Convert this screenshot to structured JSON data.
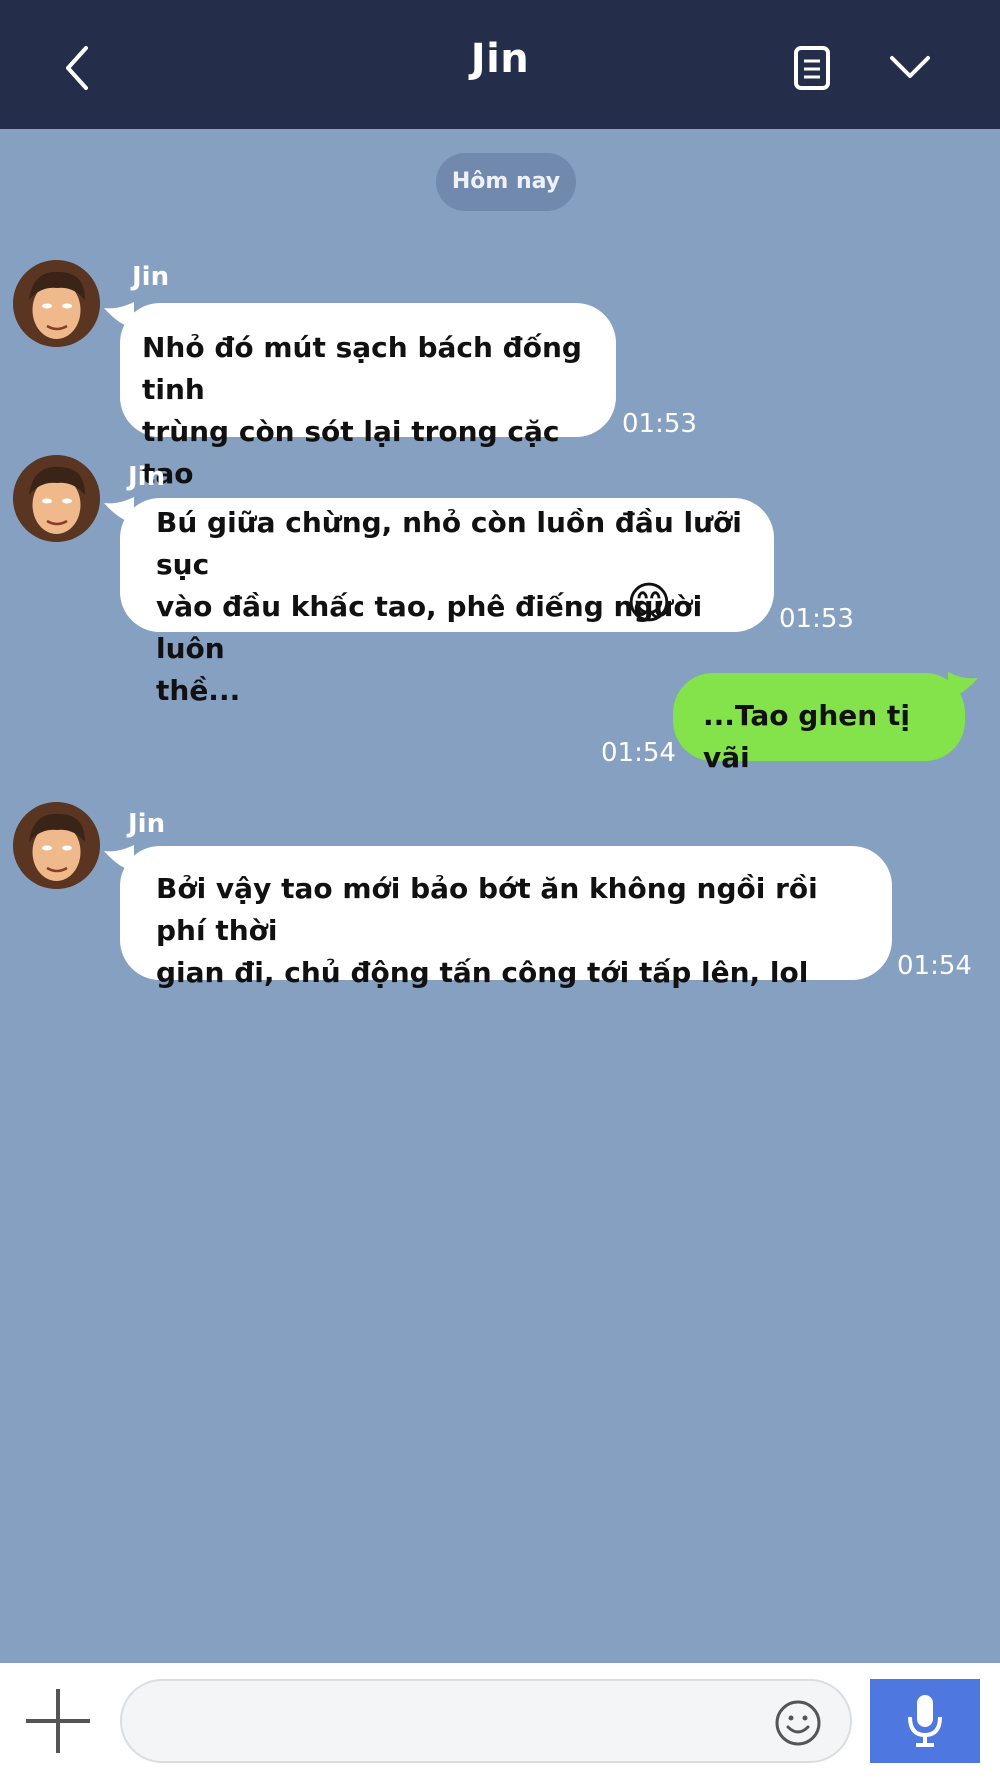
{
  "header": {
    "title": "Jin",
    "back_icon": "chevron-left-icon",
    "notes_icon": "document-icon",
    "menu_icon": "chevron-down-icon"
  },
  "date_divider": "Hôm nay",
  "messages": [
    {
      "sender": "Jin",
      "direction": "incoming",
      "lines": [
        "Nhỏ đó mút sạch bách đống tinh",
        "trùng còn sót lại trong cặc tao"
      ],
      "time": "01:53"
    },
    {
      "sender": "Jin",
      "direction": "incoming",
      "lines": [
        "Bú giữa chừng, nhỏ còn luồn đầu lưỡi sục",
        "vào đầu khấc tao, phê điếng người luôn",
        "thề..."
      ],
      "emoji": "😋",
      "time": "01:53"
    },
    {
      "direction": "outgoing",
      "lines": [
        "...Tao ghen tị vãi"
      ],
      "time": "01:54"
    },
    {
      "sender": "Jin",
      "direction": "incoming",
      "lines": [
        "Bởi vậy tao mới bảo bớt ăn không ngồi rồi phí thời",
        "gian đi, chủ động tấn công tới tấp lên, lol"
      ],
      "time": "01:54"
    }
  ],
  "footer": {
    "add_icon": "plus-icon",
    "input_value": "",
    "emoji_icon": "smiley-icon",
    "mic_icon": "microphone-icon"
  },
  "colors": {
    "header": "#242d4a",
    "background": "#86a0c1",
    "outgoing_bubble": "#84e34a",
    "incoming_bubble": "#ffffff",
    "mic_button": "#4e78e0"
  }
}
